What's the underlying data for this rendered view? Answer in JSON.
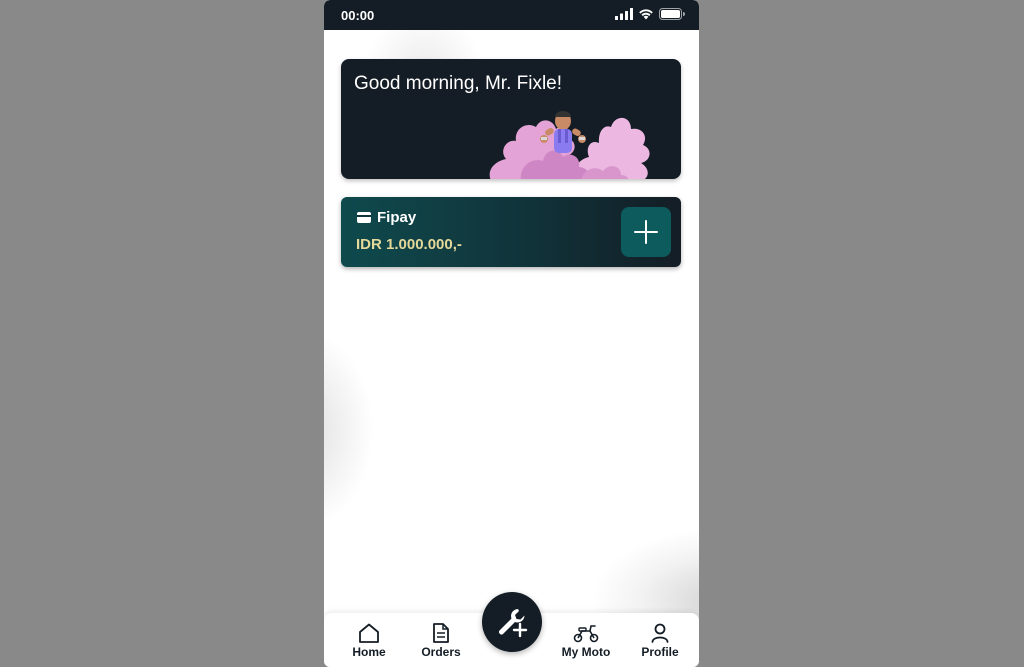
{
  "status_bar": {
    "time": "00:00",
    "icons": [
      "signal-icon",
      "wifi-icon",
      "battery-icon"
    ]
  },
  "greeting": {
    "text": "Good morning, Mr. Fixle!"
  },
  "wallet": {
    "title": "Fipay",
    "balance": "IDR 1.000.000,-",
    "icon": "card-icon",
    "action_icon": "plus-icon"
  },
  "fab": {
    "icon": "wrench-plus-icon"
  },
  "nav": {
    "items": [
      {
        "label": "Home",
        "icon": "home-icon"
      },
      {
        "label": "Orders",
        "icon": "document-icon"
      },
      {
        "label": "My Moto",
        "icon": "scooter-icon"
      },
      {
        "label": "Profile",
        "icon": "user-icon"
      }
    ]
  },
  "colors": {
    "page_background": "#898989",
    "dark": "#141d25",
    "teal": "#0d5b5c",
    "balance_text": "#e5d99a"
  }
}
